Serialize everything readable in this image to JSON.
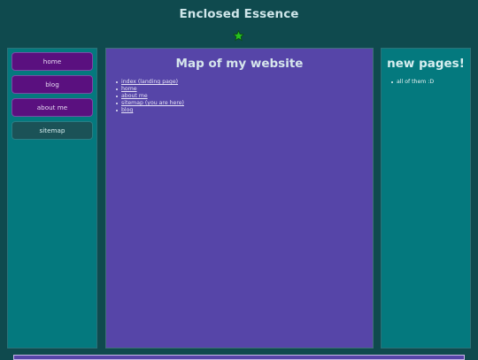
{
  "site": {
    "title": "Enclosed Essence"
  },
  "nav": {
    "items": [
      {
        "label": "home",
        "current": false
      },
      {
        "label": "blog",
        "current": false
      },
      {
        "label": "about me",
        "current": false
      },
      {
        "label": "sitemap",
        "current": true
      }
    ]
  },
  "main": {
    "title": "Map of my website",
    "links": [
      "index (landing page)",
      "home",
      "about me",
      "sitemap (you are here)",
      "blog"
    ]
  },
  "sidebar_right": {
    "title": "new pages!",
    "items": [
      "all of them :D"
    ]
  },
  "colors": {
    "background": "#0f4a4e",
    "teal_panel": "#04797e",
    "purple_panel": "#5645a8",
    "nav_button": "#5a107f",
    "nav_current": "#1b5257",
    "star": "#28c21f"
  },
  "icons": {
    "header_star": "star-icon"
  }
}
